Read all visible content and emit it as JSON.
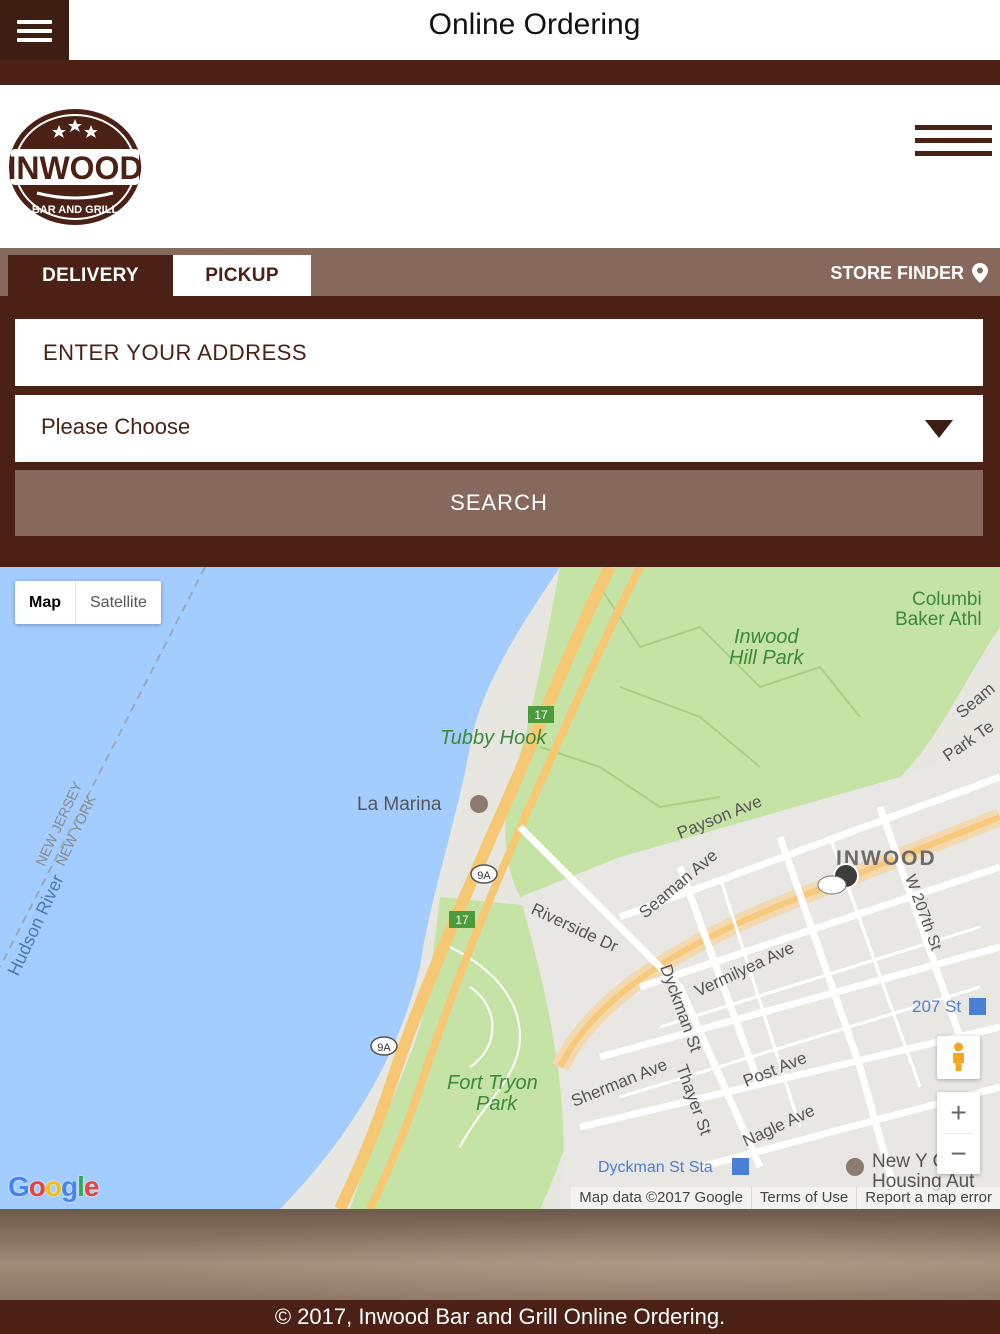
{
  "topbar": {
    "title": "Online Ordering"
  },
  "header": {
    "logo_text": "INWOOD",
    "logo_subtext": "BAR AND GRILL"
  },
  "order": {
    "tabs": [
      {
        "label": "DELIVERY",
        "active": true
      },
      {
        "label": "PICKUP",
        "active": false
      }
    ],
    "store_finder_label": "STORE FINDER",
    "address_placeholder": "ENTER YOUR ADDRESS",
    "address_value": "",
    "select_value": "Please Choose",
    "search_label": "SEARCH"
  },
  "map": {
    "type_buttons": {
      "map": "Map",
      "satellite": "Satellite"
    },
    "labels": {
      "columbia": "Columbi",
      "baker": "Baker Athl",
      "inwood_hill": "Inwood",
      "inwood_hill2": "Hill Park",
      "tubby_hook": "Tubby Hook",
      "la_marina": "La Marina",
      "nj": "NEW JERSEY",
      "ny": "NEW YORK",
      "hudson": "Hudson River",
      "payson": "Payson Ave",
      "seaman": "Seaman Ave",
      "seaman2": "Seam",
      "park_ter": "Park Te",
      "inwood": "INWOOD",
      "w207": "W 207th St",
      "riverside": "Riverside Dr",
      "vermilyea": "Vermilyea Ave",
      "dyckman": "Dyckman St",
      "st207": "207 St",
      "fort_tryon": "Fort Tryon",
      "fort_tryon2": "Park",
      "sherman": "Sherman Ave",
      "thayer": "Thayer St",
      "post": "Post Ave",
      "nagle": "Nagle Ave",
      "dyckman_sta": "Dyckman St Sta",
      "nyc_housing": "New Y   Ci",
      "nyc_housing2": "Housing Aut",
      "route17": "17",
      "route9a": "9A"
    },
    "zoom_in": "+",
    "zoom_out": "−",
    "google": [
      "G",
      "o",
      "o",
      "g",
      "l",
      "e"
    ],
    "footer": {
      "data": "Map data ©2017 Google",
      "terms": "Terms of Use",
      "report": "Report a map error"
    }
  },
  "footer": {
    "text": "© 2017, Inwood Bar and Grill Online Ordering."
  },
  "colors": {
    "brand_dark": "#4a2114",
    "brand_mid": "#87685c",
    "water": "#a3ccff",
    "park": "#c5e3a5"
  }
}
